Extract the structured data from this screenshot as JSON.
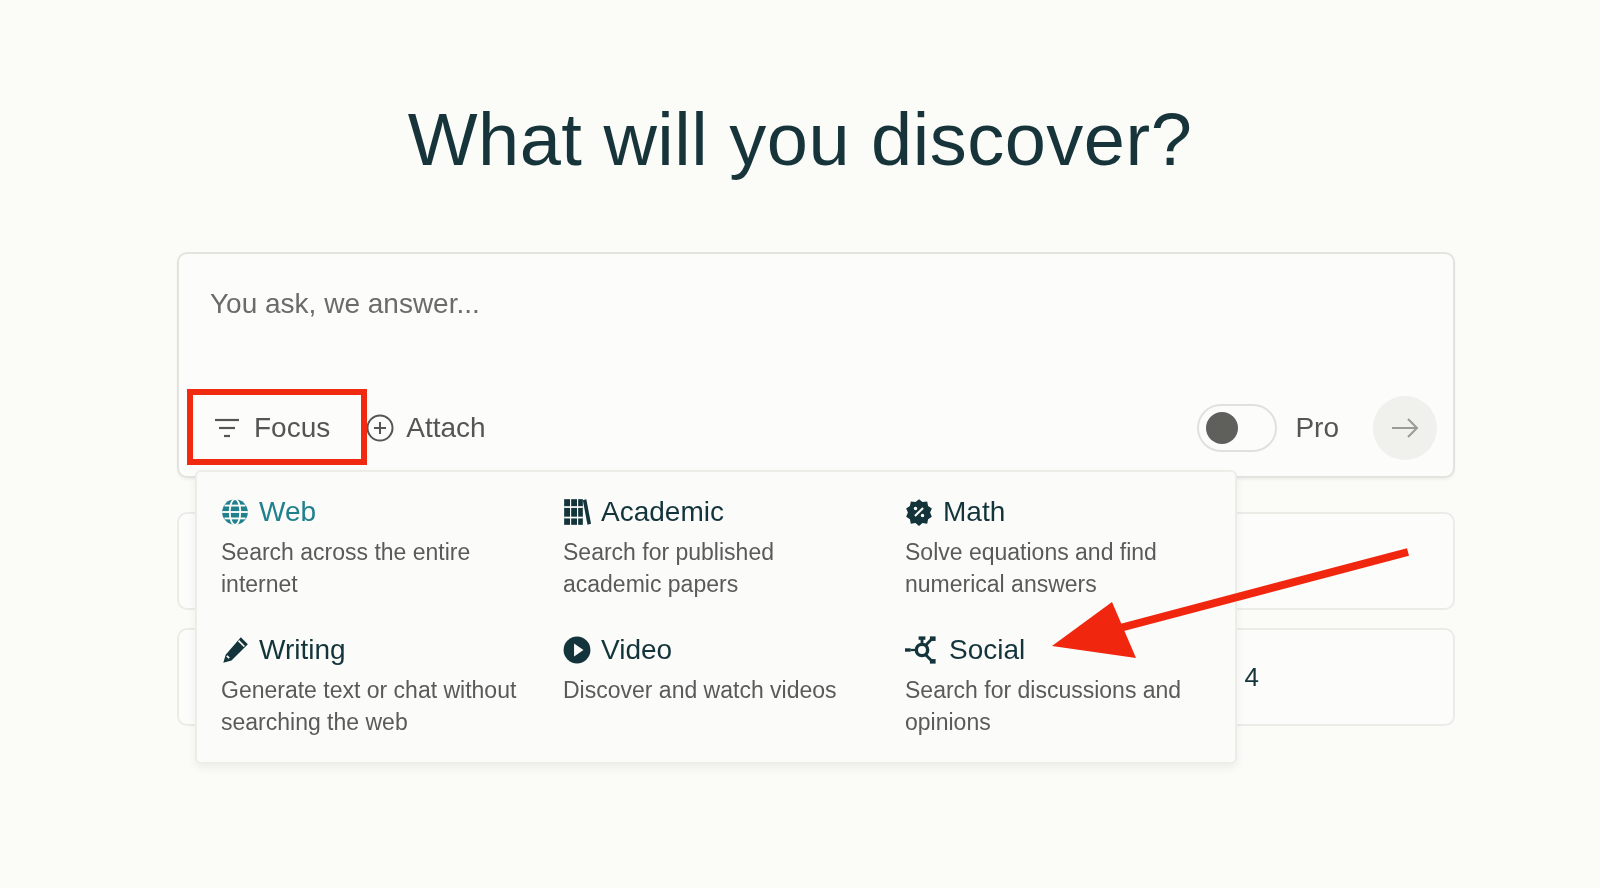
{
  "heading": "What will you discover?",
  "search": {
    "placeholder": "You ask, we answer..."
  },
  "toolbar": {
    "focus_label": "Focus",
    "attach_label": "Attach",
    "pro_label": "Pro",
    "pro_on": false
  },
  "background_cards": [
    {
      "kind": "blank"
    },
    {
      "kind": "text",
      "text": "4"
    }
  ],
  "focus_menu": [
    {
      "kind": "web",
      "title": "Web",
      "description": "Search across the entire internet",
      "selected": true
    },
    {
      "kind": "academic",
      "title": "Academic",
      "description": "Search for published academic papers",
      "selected": false
    },
    {
      "kind": "math",
      "title": "Math",
      "description": "Solve equations and find numerical answers",
      "selected": false
    },
    {
      "kind": "writing",
      "title": "Writing",
      "description": "Generate text or chat without searching the web",
      "selected": false
    },
    {
      "kind": "video",
      "title": "Video",
      "description": "Discover and watch videos",
      "selected": false
    },
    {
      "kind": "social",
      "title": "Social",
      "description": "Search for discussions and opinions",
      "selected": false
    }
  ]
}
